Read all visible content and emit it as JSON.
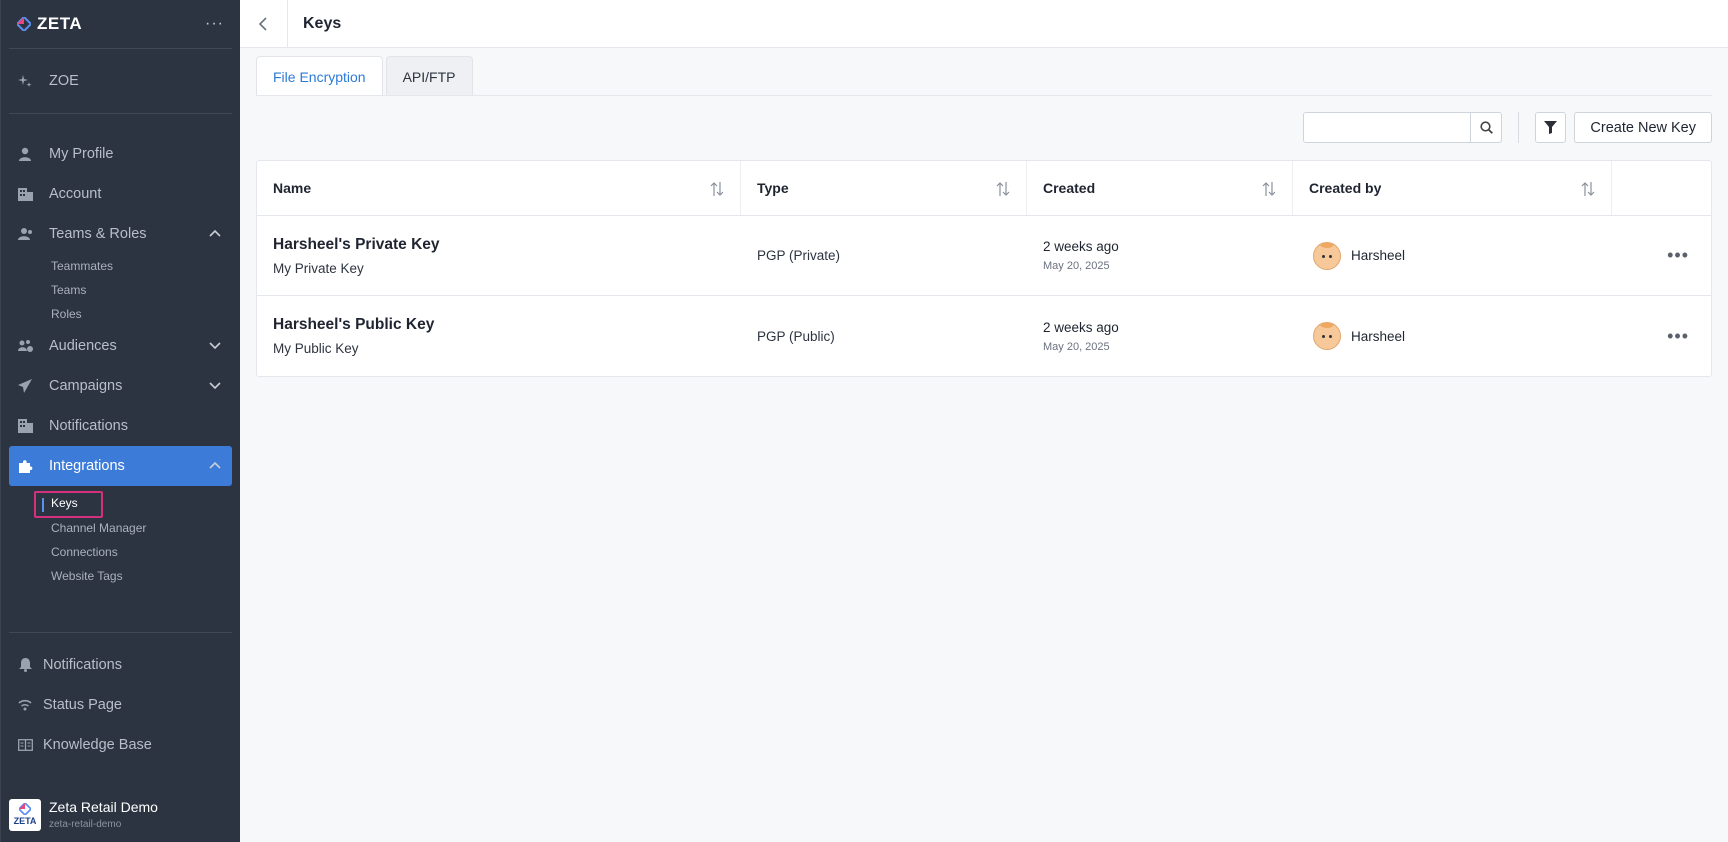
{
  "brand": {
    "name": "ZETA"
  },
  "sidebar": {
    "top_items": [
      {
        "label": "ZOE",
        "icon": "sparkle-icon"
      }
    ],
    "items": [
      {
        "label": "My Profile",
        "icon": "user-icon"
      },
      {
        "label": "Account",
        "icon": "building-icon"
      },
      {
        "label": "Teams & Roles",
        "icon": "team-icon",
        "expanded": true,
        "children": [
          "Teammates",
          "Teams",
          "Roles"
        ]
      },
      {
        "label": "Audiences",
        "icon": "audience-icon",
        "expanded": false
      },
      {
        "label": "Campaigns",
        "icon": "send-icon",
        "expanded": false
      },
      {
        "label": "Notifications",
        "icon": "grid-icon"
      },
      {
        "label": "Integrations",
        "icon": "puzzle-icon",
        "expanded": true,
        "active": true,
        "children": [
          "Keys",
          "Channel Manager",
          "Connections",
          "Website Tags"
        ]
      }
    ],
    "bottom_items": [
      {
        "label": "Notifications",
        "icon": "bell-icon"
      },
      {
        "label": "Status Page",
        "icon": "signal-icon"
      },
      {
        "label": "Knowledge Base",
        "icon": "book-icon"
      }
    ],
    "org": {
      "name": "Zeta Retail Demo",
      "slug": "zeta-retail-demo",
      "badge": "ZETA"
    }
  },
  "header": {
    "title": "Keys"
  },
  "tabs": [
    {
      "label": "File Encryption",
      "active": true
    },
    {
      "label": "API/FTP",
      "active": false
    }
  ],
  "toolbar": {
    "search_placeholder": "",
    "create_label": "Create New Key"
  },
  "table": {
    "columns": [
      "Name",
      "Type",
      "Created",
      "Created by"
    ],
    "rows": [
      {
        "name": "Harsheel's Private Key",
        "description": "My Private Key",
        "type": "PGP (Private)",
        "created_relative": "2 weeks ago",
        "created_date": "May 20, 2025",
        "created_by": "Harsheel"
      },
      {
        "name": "Harsheel's Public Key",
        "description": "My Public Key",
        "type": "PGP (Public)",
        "created_relative": "2 weeks ago",
        "created_date": "May 20, 2025",
        "created_by": "Harsheel"
      }
    ]
  },
  "colors": {
    "sidebar_bg": "#2c3441",
    "active_blue": "#3d7bd9",
    "tab_active": "#2d7ad6",
    "highlight": "#d4307d"
  }
}
